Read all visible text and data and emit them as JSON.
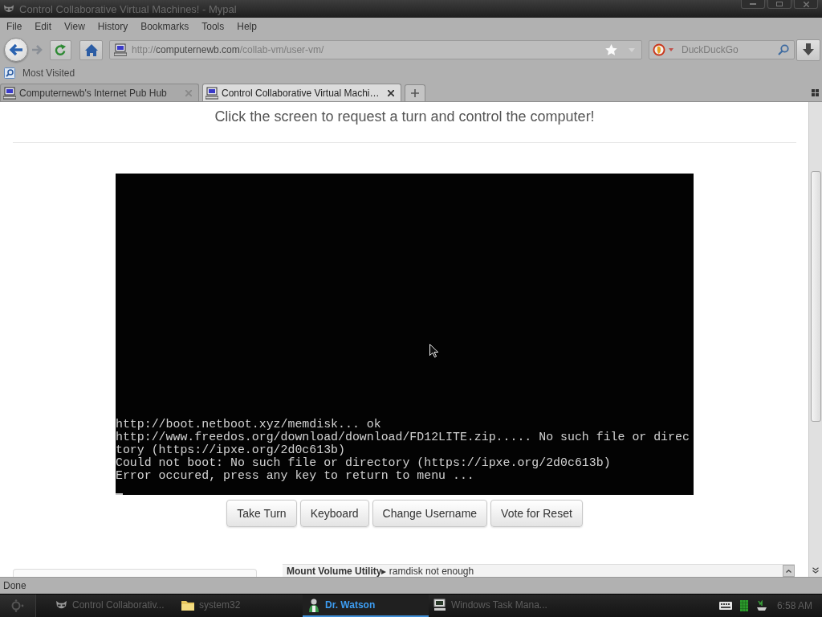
{
  "window": {
    "title": "Control Collaborative Virtual Machines! - Mypal"
  },
  "menu_bar": [
    "File",
    "Edit",
    "View",
    "History",
    "Bookmarks",
    "Tools",
    "Help"
  ],
  "navigation": {
    "url": {
      "scheme": "http://",
      "host": "computernewb.com",
      "path": "/collab-vm/user-vm/"
    },
    "search": {
      "placeholder": "DuckDuckGo"
    }
  },
  "bookmarks_toolbar": [
    "Most Visited"
  ],
  "tabs": [
    {
      "label": "Computernewb's Internet Pub Hub",
      "selected": false
    },
    {
      "label": "Control Collaborative Virtual Machi…",
      "selected": true
    }
  ],
  "page": {
    "heading": "Click the screen to request a turn and control the computer!",
    "vm_screen": {
      "lines": [
        "http://boot.netboot.xyz/memdisk... ok",
        "http://www.freedos.org/download/download/FD12LITE.zip..... No such file or direc",
        "tory (https://ipxe.org/2d0c613b)",
        "Could not boot: No such file or directory (https://ipxe.org/2d0c613b)",
        "Error occured, press any key to return to menu ..."
      ]
    },
    "buttons": [
      "Take Turn",
      "Keyboard",
      "Change Username",
      "Vote for Reset"
    ],
    "chat": [
      "**Mount Volume Utility**▸ ramdisk not enough"
    ]
  },
  "status_bar": {
    "text": "Done"
  },
  "taskbar": {
    "items": [
      {
        "label": "Control Collaborativ...",
        "kind": "browser",
        "selected": false
      },
      {
        "label": "system32",
        "kind": "folder",
        "selected": false
      },
      {
        "label": "Dr. Watson",
        "kind": "doctor",
        "selected": true
      },
      {
        "label": "Windows Task Mana...",
        "kind": "monitor",
        "selected": false
      }
    ],
    "clock": "6:58 AM"
  }
}
